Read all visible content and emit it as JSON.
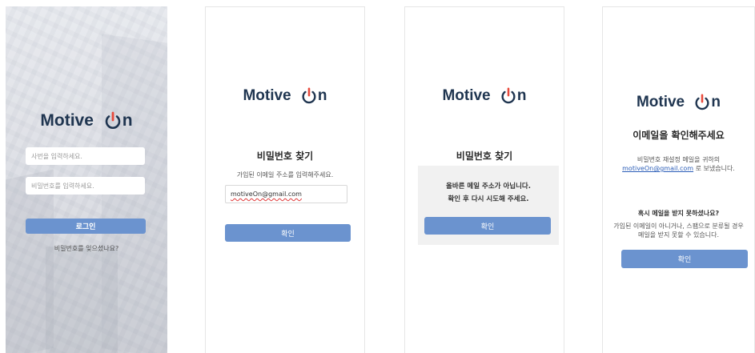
{
  "brand": {
    "name": "Motive",
    "suffix": "n",
    "power_icon_color": "#3a7ad8"
  },
  "colors": {
    "primary_button": "#6b93cf",
    "logo_text": "#1f3550"
  },
  "login": {
    "id_placeholder": "사번을 입력하세요.",
    "password_placeholder": "비밀번호를 입력하세요.",
    "login_button": "로그인",
    "forgot_link": "비밀번호를 잊으셨나요?"
  },
  "find_password": {
    "title": "비밀번호 찾기",
    "instruction": "가입된 이메일 주소를 입력해주세요.",
    "email_value": "motiveOn@gmail.com",
    "confirm_button": "확인"
  },
  "invalid_email": {
    "title": "비밀번호 찾기",
    "error_line1": "올바른 메일 주소가 아닙니다.",
    "error_line2": "확인 후 다시 시도해 주세요.",
    "confirm_button": "확인"
  },
  "check_email": {
    "title": "이메일을 확인해주세요",
    "line1": "비밀번호 재설정 메일을 귀하의",
    "email": "motiveOn@gmail.com",
    "line2_suffix": " 로 보냈습니다.",
    "not_received_title": "혹시 메일을 받지 못하셨나요?",
    "not_received_line1": "가입된 이메일이 아니거나, 스팸으로 분류될 경우",
    "not_received_line2": "메일을 받지 못할 수 있습니다.",
    "confirm_button": "확인"
  }
}
